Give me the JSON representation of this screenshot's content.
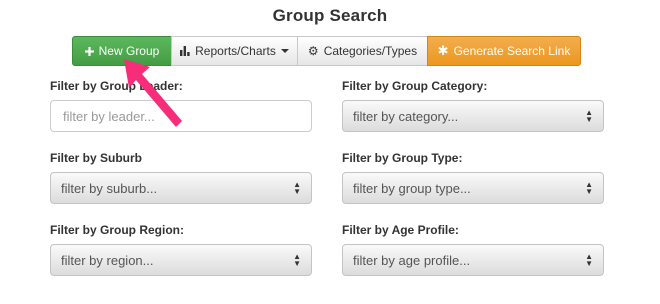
{
  "page": {
    "title": "Group Search"
  },
  "toolbar": {
    "new_group": "New Group",
    "reports": "Reports/Charts",
    "categories": "Categories/Types",
    "generate_link": "Generate Search Link"
  },
  "icons": {
    "new_group": "plus-icon",
    "reports": "bar-chart-icon",
    "categories": "gear-icon",
    "generate_link": "asterisk-icon"
  },
  "colors": {
    "success": "#5cb85c",
    "warning": "#f0ad4e",
    "pointer": "#f72d7a"
  },
  "filters": {
    "leader": {
      "label": "Filter by Group Leader:",
      "placeholder": "filter by leader..."
    },
    "category": {
      "label": "Filter by Group Category:",
      "placeholder": "filter by category..."
    },
    "suburb": {
      "label": "Filter by Suburb",
      "placeholder": "filter by suburb..."
    },
    "group_type": {
      "label": "Filter by Group Type:",
      "placeholder": "filter by group type..."
    },
    "region": {
      "label": "Filter by Group Region:",
      "placeholder": "filter by region..."
    },
    "age_profile": {
      "label": "Filter by Age Profile:",
      "placeholder": "filter by age profile..."
    }
  }
}
